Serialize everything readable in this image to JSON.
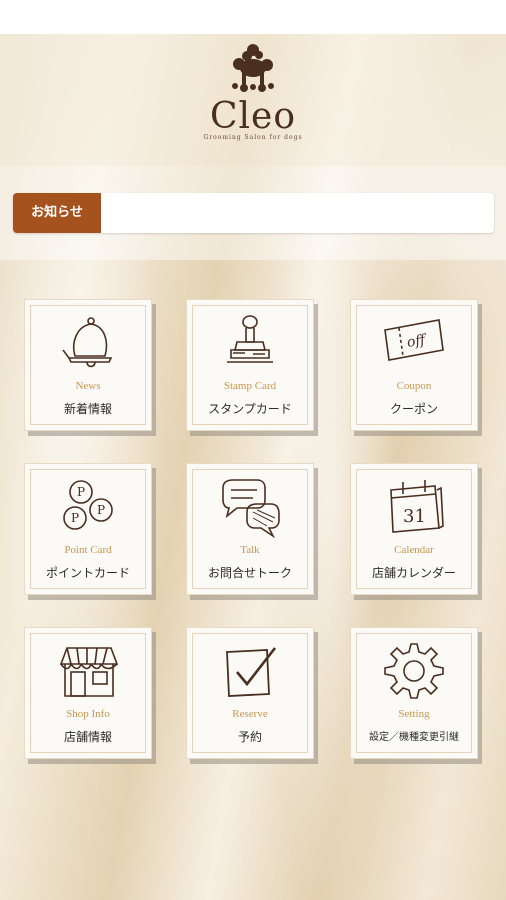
{
  "brand": {
    "name": "Cleo",
    "tagline": "Grooming Salon for dogs"
  },
  "news": {
    "label": "お知らせ",
    "text": ""
  },
  "menu": [
    {
      "en": "News",
      "jp": "新着情報",
      "icon": "bell-icon"
    },
    {
      "en": "Stamp Card",
      "jp": "スタンプカード",
      "icon": "stamp-icon"
    },
    {
      "en": "Coupon",
      "jp": "クーポン",
      "icon": "coupon-icon",
      "icon_text": "off"
    },
    {
      "en": "Point Card",
      "jp": "ポイントカード",
      "icon": "coins-icon",
      "icon_text": "P"
    },
    {
      "en": "Talk",
      "jp": "お問合せトーク",
      "icon": "chat-bubbles-icon"
    },
    {
      "en": "Calendar",
      "jp": "店舗カレンダー",
      "icon": "calendar-icon",
      "icon_text": "31"
    },
    {
      "en": "Shop Info",
      "jp": "店舗情報",
      "icon": "shop-icon"
    },
    {
      "en": "Reserve",
      "jp": "予約",
      "icon": "checkbox-icon"
    },
    {
      "en": "Setting",
      "jp": "設定／機種変更引継",
      "icon": "gear-icon"
    }
  ],
  "colors": {
    "accent": "#a5521f",
    "label_gold": "#c9954d",
    "icon_brown": "#4a2e1e"
  }
}
